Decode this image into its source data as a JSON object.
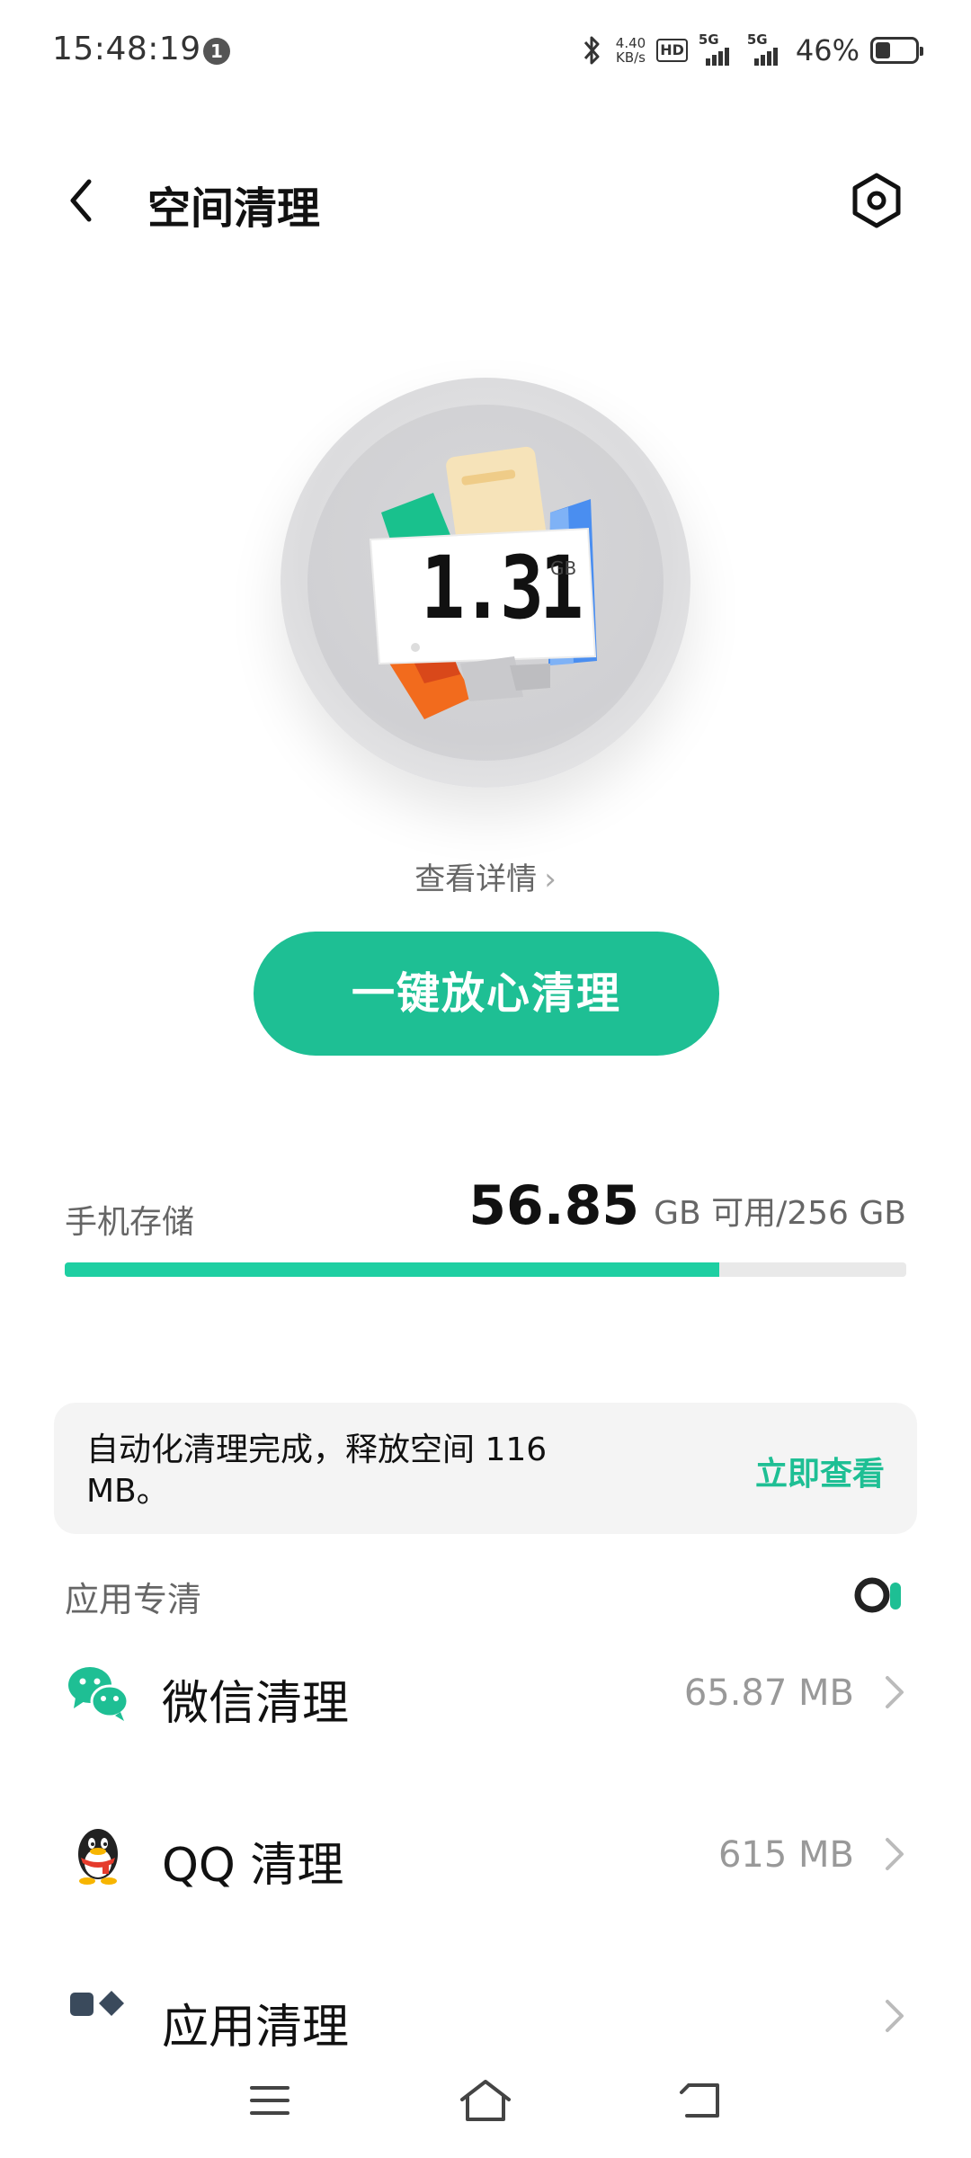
{
  "status_bar": {
    "time": "15:48:19",
    "notification_count": "1",
    "net_speed_value": "4.40",
    "net_speed_unit": "KB/s",
    "hd_label": "HD",
    "sim1_label": "5G",
    "sim2_label": "5G",
    "battery_percent": "46%",
    "battery_level": 0.46
  },
  "header": {
    "title": "空间清理"
  },
  "hero": {
    "junk_value": "1.31",
    "junk_unit": "GB"
  },
  "view_details": "查看详情",
  "clean_button": "一键放心清理",
  "storage": {
    "label": "手机存储",
    "free_value": "56.85",
    "total_text": "GB 可用/256 GB",
    "used_fraction": 0.778
  },
  "banner": {
    "text": "自动化清理完成，释放空间 116 MB。",
    "action": "立即查看"
  },
  "section": {
    "title": "应用专清"
  },
  "list": [
    {
      "label": "微信清理",
      "size": "65.87 MB",
      "icon": "wechat-icon"
    },
    {
      "label": "QQ 清理",
      "size": "615 MB",
      "icon": "qq-icon"
    },
    {
      "label": "应用清理",
      "size": "",
      "icon": "apps-icon"
    }
  ],
  "colors": {
    "accent": "#1ebf94",
    "bar_fill": "#1ecfa2"
  }
}
